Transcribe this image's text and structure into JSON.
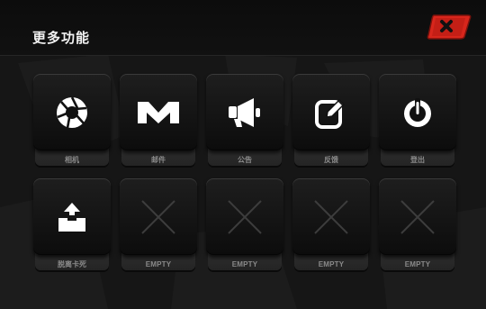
{
  "window": {
    "title": "更多功能"
  },
  "close": {
    "icon": "close-icon",
    "accent": "#e0281e"
  },
  "tiles": [
    {
      "label": "相机",
      "icon": "camera-aperture-icon",
      "empty": false
    },
    {
      "label": "邮件",
      "icon": "mail-icon",
      "empty": false
    },
    {
      "label": "公告",
      "icon": "megaphone-icon",
      "empty": false
    },
    {
      "label": "反馈",
      "icon": "feedback-edit-icon",
      "empty": false
    },
    {
      "label": "登出",
      "icon": "power-icon",
      "empty": false
    },
    {
      "label": "脱离卡死",
      "icon": "unstuck-eject-icon",
      "empty": false
    },
    {
      "label": "EMPTY",
      "icon": "empty-x-icon",
      "empty": true
    },
    {
      "label": "EMPTY",
      "icon": "empty-x-icon",
      "empty": true
    },
    {
      "label": "EMPTY",
      "icon": "empty-x-icon",
      "empty": true
    },
    {
      "label": "EMPTY",
      "icon": "empty-x-icon",
      "empty": true
    }
  ]
}
